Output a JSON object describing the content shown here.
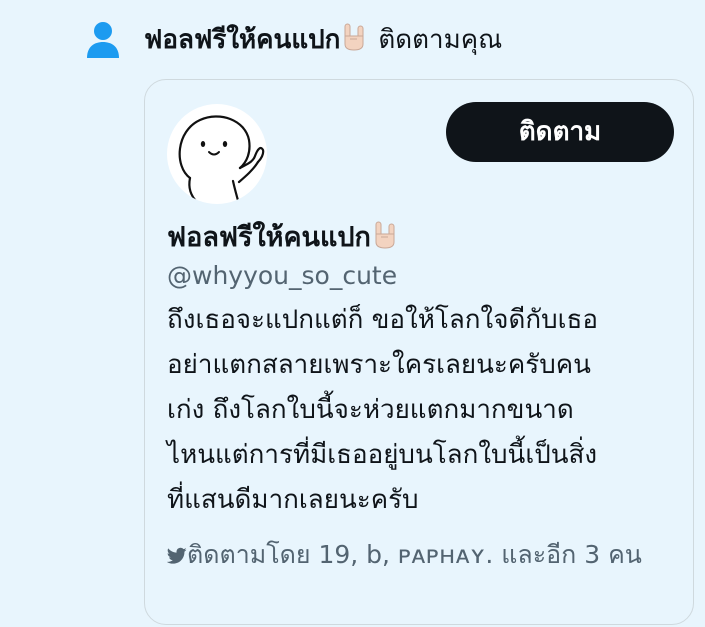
{
  "notification": {
    "icon": "person-icon",
    "name": "ฟอลฟรีให้คนแปก",
    "emoji": "🤘",
    "action": "ติดตามคุณ"
  },
  "card": {
    "follow_label": "ติดตาม",
    "display_name": "ฟอลฟรีให้คนแปก",
    "handle": "@whyyou_so_cute",
    "bio": "ถึงเธอจะแปกแต่ก็ ขอให้โลกใจดีกับเธอ\nอย่าแตกสลายเพราะใครเลยนะครับคน\nเก่ง ถึงโลกใบนี้จะห่วยแตกมากขนาด\nไหนแต่การที่มีเธออยู่บนโลกใบนี้เป็นสิ่ง\nที่แสนดีมากเลยนะครับ",
    "followed_by": "ติดตามโดย 19, b, ᴘᴀᴘʜᴀʏ. และอีก 3 คน"
  },
  "colors": {
    "background": "#e8f5fd",
    "accent_blue": "#1d9bf0",
    "button_bg": "#0f1419",
    "secondary_text": "#536471"
  }
}
